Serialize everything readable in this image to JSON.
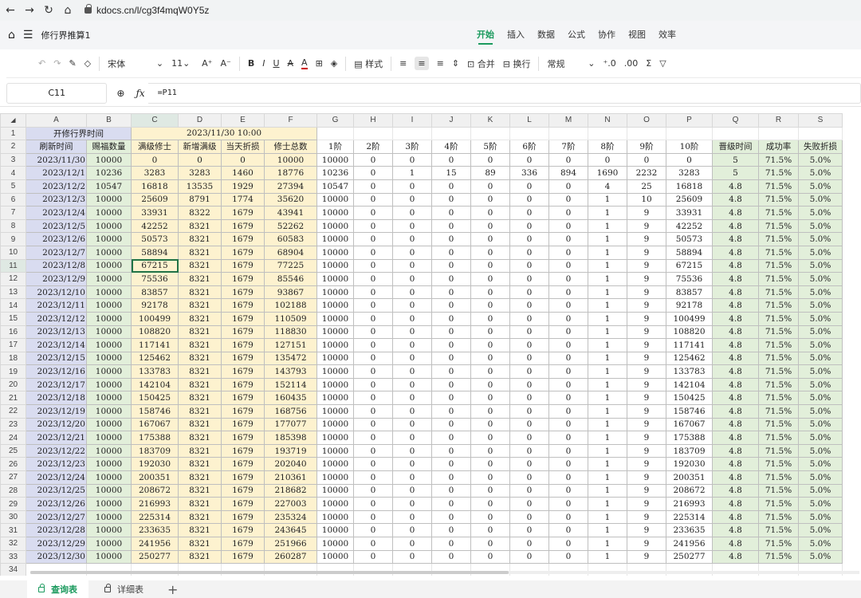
{
  "browser": {
    "url": "kdocs.cn/l/cg3f4mqW0Y5z"
  },
  "app": {
    "doc_title": "修行界推算1",
    "tabs": [
      "开始",
      "插入",
      "数据",
      "公式",
      "协作",
      "视图",
      "效率"
    ],
    "active_tab": "开始"
  },
  "toolbar": {
    "font_name": "宋体",
    "font_size": "11",
    "style_label": "样式",
    "merge_label": "合并",
    "wrap_label": "换行",
    "number_format": "常规"
  },
  "formula_bar": {
    "cell_ref": "C11",
    "formula": "=P11"
  },
  "grid": {
    "columns": [
      "A",
      "B",
      "C",
      "D",
      "E",
      "F",
      "G",
      "H",
      "I",
      "J",
      "K",
      "L",
      "M",
      "N",
      "O",
      "P",
      "Q",
      "R",
      "S"
    ],
    "row1": {
      "num": "1",
      "label": "开修行界时间",
      "value": "2023/11/30 10:00"
    },
    "headers": [
      "刷新时间",
      "赐福数量",
      "满级修士",
      "新增满级",
      "当天折损",
      "修士总数",
      "1阶",
      "2阶",
      "3阶",
      "4阶",
      "5阶",
      "6阶",
      "7阶",
      "8阶",
      "9阶",
      "10阶",
      "晋级时间",
      "成功率",
      "失败折损"
    ],
    "rows": [
      [
        "2023/11/30",
        "10000",
        "0",
        "0",
        "0",
        "10000",
        "10000",
        "0",
        "0",
        "0",
        "0",
        "0",
        "0",
        "0",
        "0",
        "0",
        "5",
        "71.5%",
        "5.0%"
      ],
      [
        "2023/12/1",
        "10236",
        "3283",
        "3283",
        "1460",
        "18776",
        "10236",
        "0",
        "1",
        "15",
        "89",
        "336",
        "894",
        "1690",
        "2232",
        "3283",
        "5",
        "71.5%",
        "5.0%"
      ],
      [
        "2023/12/2",
        "10547",
        "16818",
        "13535",
        "1929",
        "27394",
        "10547",
        "0",
        "0",
        "0",
        "0",
        "0",
        "0",
        "4",
        "25",
        "16818",
        "4.8",
        "71.5%",
        "5.0%"
      ],
      [
        "2023/12/3",
        "10000",
        "25609",
        "8791",
        "1774",
        "35620",
        "10000",
        "0",
        "0",
        "0",
        "0",
        "0",
        "0",
        "1",
        "10",
        "25609",
        "4.8",
        "71.5%",
        "5.0%"
      ],
      [
        "2023/12/4",
        "10000",
        "33931",
        "8322",
        "1679",
        "43941",
        "10000",
        "0",
        "0",
        "0",
        "0",
        "0",
        "0",
        "1",
        "9",
        "33931",
        "4.8",
        "71.5%",
        "5.0%"
      ],
      [
        "2023/12/5",
        "10000",
        "42252",
        "8321",
        "1679",
        "52262",
        "10000",
        "0",
        "0",
        "0",
        "0",
        "0",
        "0",
        "1",
        "9",
        "42252",
        "4.8",
        "71.5%",
        "5.0%"
      ],
      [
        "2023/12/6",
        "10000",
        "50573",
        "8321",
        "1679",
        "60583",
        "10000",
        "0",
        "0",
        "0",
        "0",
        "0",
        "0",
        "1",
        "9",
        "50573",
        "4.8",
        "71.5%",
        "5.0%"
      ],
      [
        "2023/12/7",
        "10000",
        "58894",
        "8321",
        "1679",
        "68904",
        "10000",
        "0",
        "0",
        "0",
        "0",
        "0",
        "0",
        "1",
        "9",
        "58894",
        "4.8",
        "71.5%",
        "5.0%"
      ],
      [
        "2023/12/8",
        "10000",
        "67215",
        "8321",
        "1679",
        "77225",
        "10000",
        "0",
        "0",
        "0",
        "0",
        "0",
        "0",
        "1",
        "9",
        "67215",
        "4.8",
        "71.5%",
        "5.0%"
      ],
      [
        "2023/12/9",
        "10000",
        "75536",
        "8321",
        "1679",
        "85546",
        "10000",
        "0",
        "0",
        "0",
        "0",
        "0",
        "0",
        "1",
        "9",
        "75536",
        "4.8",
        "71.5%",
        "5.0%"
      ],
      [
        "2023/12/10",
        "10000",
        "83857",
        "8321",
        "1679",
        "93867",
        "10000",
        "0",
        "0",
        "0",
        "0",
        "0",
        "0",
        "1",
        "9",
        "83857",
        "4.8",
        "71.5%",
        "5.0%"
      ],
      [
        "2023/12/11",
        "10000",
        "92178",
        "8321",
        "1679",
        "102188",
        "10000",
        "0",
        "0",
        "0",
        "0",
        "0",
        "0",
        "1",
        "9",
        "92178",
        "4.8",
        "71.5%",
        "5.0%"
      ],
      [
        "2023/12/12",
        "10000",
        "100499",
        "8321",
        "1679",
        "110509",
        "10000",
        "0",
        "0",
        "0",
        "0",
        "0",
        "0",
        "1",
        "9",
        "100499",
        "4.8",
        "71.5%",
        "5.0%"
      ],
      [
        "2023/12/13",
        "10000",
        "108820",
        "8321",
        "1679",
        "118830",
        "10000",
        "0",
        "0",
        "0",
        "0",
        "0",
        "0",
        "1",
        "9",
        "108820",
        "4.8",
        "71.5%",
        "5.0%"
      ],
      [
        "2023/12/14",
        "10000",
        "117141",
        "8321",
        "1679",
        "127151",
        "10000",
        "0",
        "0",
        "0",
        "0",
        "0",
        "0",
        "1",
        "9",
        "117141",
        "4.8",
        "71.5%",
        "5.0%"
      ],
      [
        "2023/12/15",
        "10000",
        "125462",
        "8321",
        "1679",
        "135472",
        "10000",
        "0",
        "0",
        "0",
        "0",
        "0",
        "0",
        "1",
        "9",
        "125462",
        "4.8",
        "71.5%",
        "5.0%"
      ],
      [
        "2023/12/16",
        "10000",
        "133783",
        "8321",
        "1679",
        "143793",
        "10000",
        "0",
        "0",
        "0",
        "0",
        "0",
        "0",
        "1",
        "9",
        "133783",
        "4.8",
        "71.5%",
        "5.0%"
      ],
      [
        "2023/12/17",
        "10000",
        "142104",
        "8321",
        "1679",
        "152114",
        "10000",
        "0",
        "0",
        "0",
        "0",
        "0",
        "0",
        "1",
        "9",
        "142104",
        "4.8",
        "71.5%",
        "5.0%"
      ],
      [
        "2023/12/18",
        "10000",
        "150425",
        "8321",
        "1679",
        "160435",
        "10000",
        "0",
        "0",
        "0",
        "0",
        "0",
        "0",
        "1",
        "9",
        "150425",
        "4.8",
        "71.5%",
        "5.0%"
      ],
      [
        "2023/12/19",
        "10000",
        "158746",
        "8321",
        "1679",
        "168756",
        "10000",
        "0",
        "0",
        "0",
        "0",
        "0",
        "0",
        "1",
        "9",
        "158746",
        "4.8",
        "71.5%",
        "5.0%"
      ],
      [
        "2023/12/20",
        "10000",
        "167067",
        "8321",
        "1679",
        "177077",
        "10000",
        "0",
        "0",
        "0",
        "0",
        "0",
        "0",
        "1",
        "9",
        "167067",
        "4.8",
        "71.5%",
        "5.0%"
      ],
      [
        "2023/12/21",
        "10000",
        "175388",
        "8321",
        "1679",
        "185398",
        "10000",
        "0",
        "0",
        "0",
        "0",
        "0",
        "0",
        "1",
        "9",
        "175388",
        "4.8",
        "71.5%",
        "5.0%"
      ],
      [
        "2023/12/22",
        "10000",
        "183709",
        "8321",
        "1679",
        "193719",
        "10000",
        "0",
        "0",
        "0",
        "0",
        "0",
        "0",
        "1",
        "9",
        "183709",
        "4.8",
        "71.5%",
        "5.0%"
      ],
      [
        "2023/12/23",
        "10000",
        "192030",
        "8321",
        "1679",
        "202040",
        "10000",
        "0",
        "0",
        "0",
        "0",
        "0",
        "0",
        "1",
        "9",
        "192030",
        "4.8",
        "71.5%",
        "5.0%"
      ],
      [
        "2023/12/24",
        "10000",
        "200351",
        "8321",
        "1679",
        "210361",
        "10000",
        "0",
        "0",
        "0",
        "0",
        "0",
        "0",
        "1",
        "9",
        "200351",
        "4.8",
        "71.5%",
        "5.0%"
      ],
      [
        "2023/12/25",
        "10000",
        "208672",
        "8321",
        "1679",
        "218682",
        "10000",
        "0",
        "0",
        "0",
        "0",
        "0",
        "0",
        "1",
        "9",
        "208672",
        "4.8",
        "71.5%",
        "5.0%"
      ],
      [
        "2023/12/26",
        "10000",
        "216993",
        "8321",
        "1679",
        "227003",
        "10000",
        "0",
        "0",
        "0",
        "0",
        "0",
        "0",
        "1",
        "9",
        "216993",
        "4.8",
        "71.5%",
        "5.0%"
      ],
      [
        "2023/12/27",
        "10000",
        "225314",
        "8321",
        "1679",
        "235324",
        "10000",
        "0",
        "0",
        "0",
        "0",
        "0",
        "0",
        "1",
        "9",
        "225314",
        "4.8",
        "71.5%",
        "5.0%"
      ],
      [
        "2023/12/28",
        "10000",
        "233635",
        "8321",
        "1679",
        "243645",
        "10000",
        "0",
        "0",
        "0",
        "0",
        "0",
        "0",
        "1",
        "9",
        "233635",
        "4.8",
        "71.5%",
        "5.0%"
      ],
      [
        "2023/12/29",
        "10000",
        "241956",
        "8321",
        "1679",
        "251966",
        "10000",
        "0",
        "0",
        "0",
        "0",
        "0",
        "0",
        "1",
        "9",
        "241956",
        "4.8",
        "71.5%",
        "5.0%"
      ],
      [
        "2023/12/30",
        "10000",
        "250277",
        "8321",
        "1679",
        "260287",
        "10000",
        "0",
        "0",
        "0",
        "0",
        "0",
        "0",
        "1",
        "9",
        "250277",
        "4.8",
        "71.5%",
        "5.0%"
      ]
    ],
    "last_row_num": "34"
  },
  "sheets": [
    "查询表",
    "详细表"
  ],
  "active_sheet": "查询表",
  "colors": {
    "accent": "#1b9a5e",
    "blue_fill": "#d9dcf0",
    "green_fill": "#e2efda",
    "yellow_fill": "#fdf2cf"
  }
}
